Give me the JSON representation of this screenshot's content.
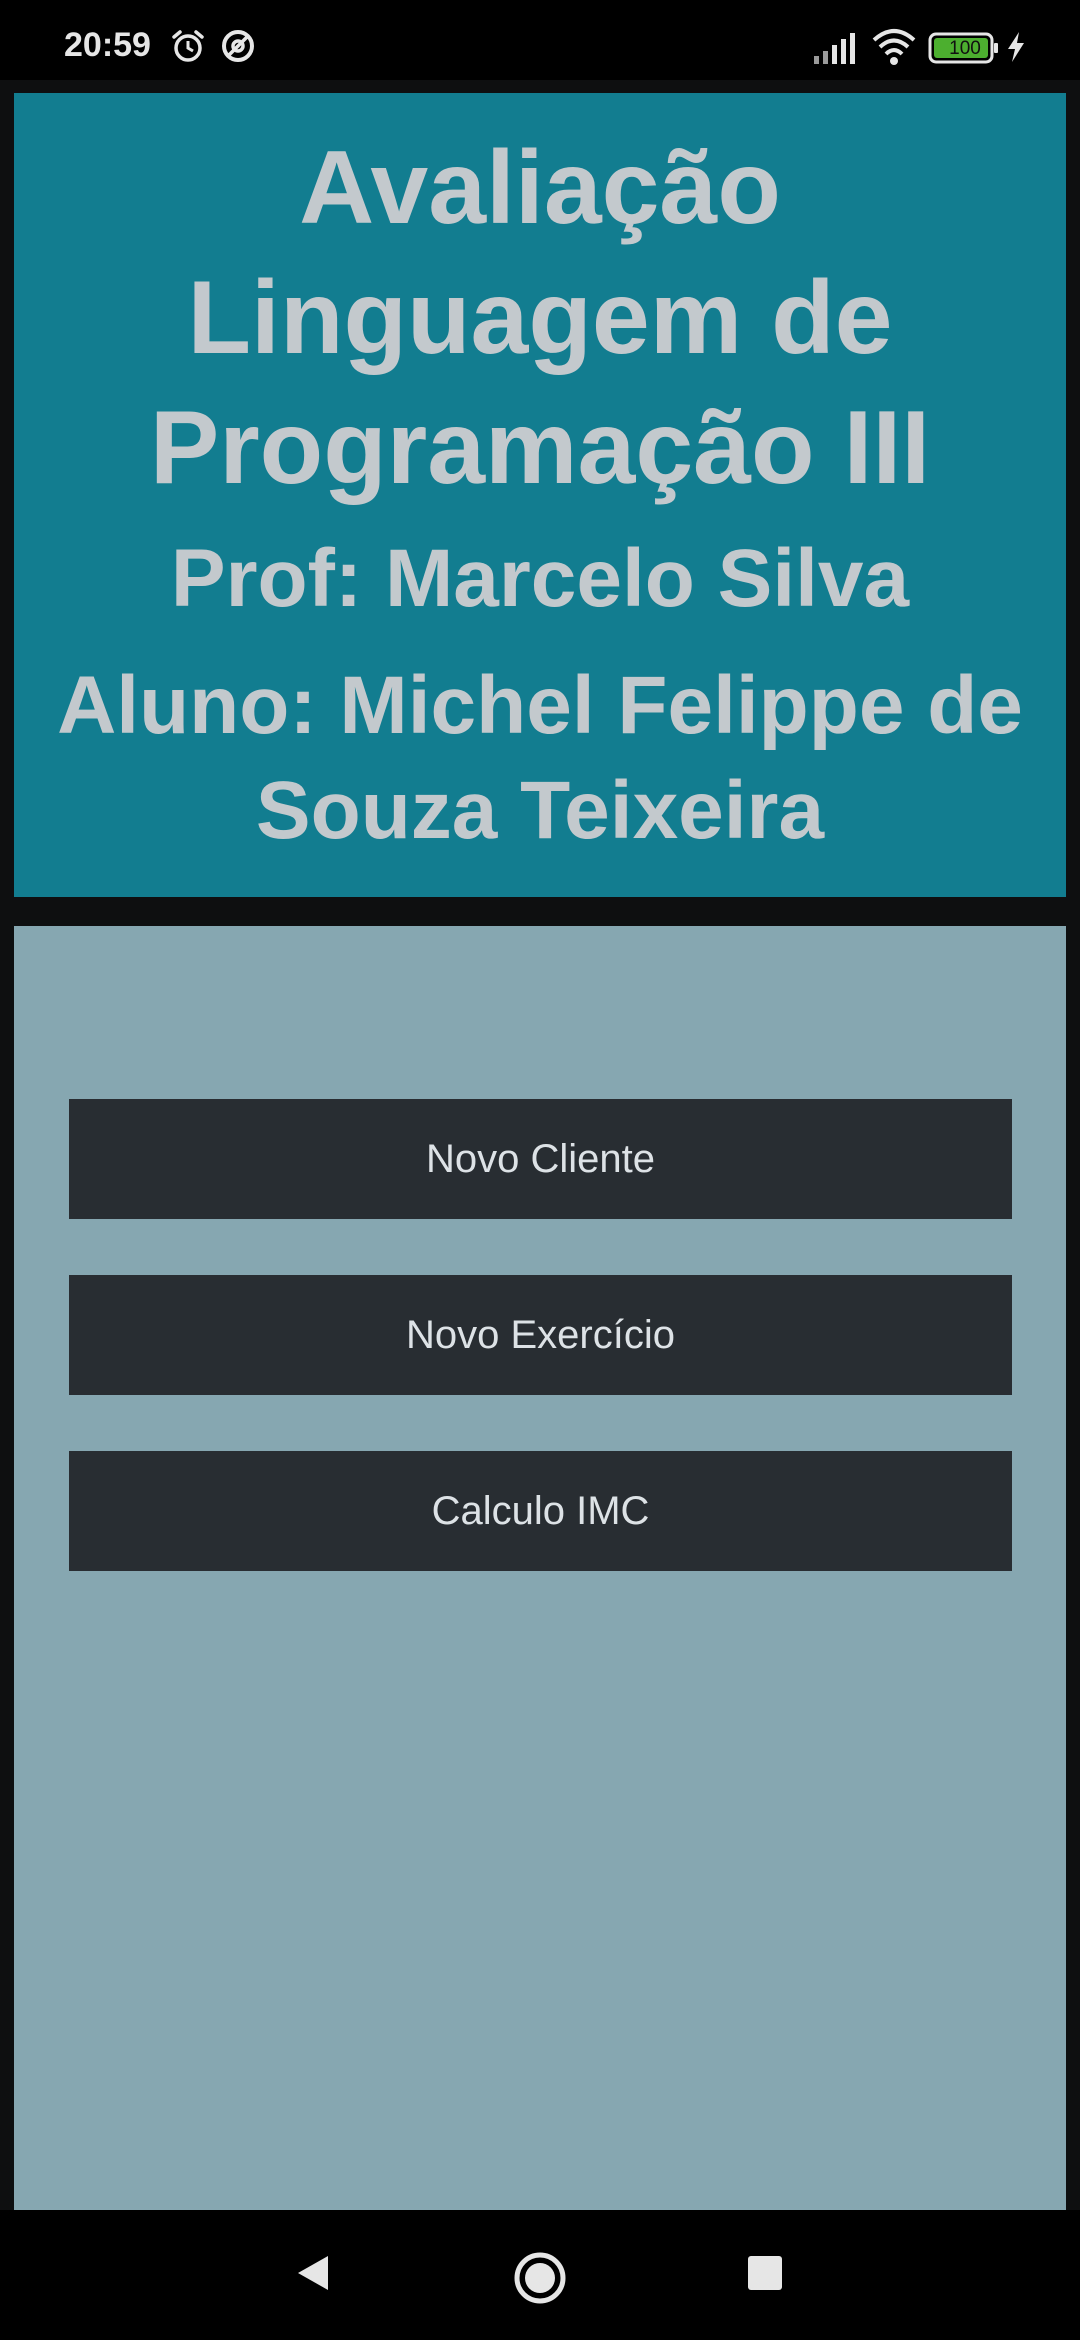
{
  "status_bar": {
    "time": "20:59",
    "battery_level": "100",
    "icons": [
      "alarm-icon",
      "dnd-icon",
      "signal-icon",
      "wifi-icon",
      "battery-icon",
      "charging-icon"
    ]
  },
  "header": {
    "title": "Avaliação Linguagem de Programação III",
    "professor": "Prof: Marcelo Silva",
    "student": "Aluno: Michel Felippe de Souza Teixeira"
  },
  "menu": {
    "buttons": [
      {
        "label": "Novo Cliente"
      },
      {
        "label": "Novo Exercício"
      },
      {
        "label": "Calculo IMC"
      }
    ]
  },
  "nav_bar": {
    "icons": [
      "back-icon",
      "home-icon",
      "recents-icon"
    ]
  },
  "colors": {
    "header_bg": "#127d90",
    "panel_bg": "#86a7b1",
    "button_bg": "#282d32",
    "header_text": "#c3c9cd",
    "button_text": "#dde2e6"
  }
}
